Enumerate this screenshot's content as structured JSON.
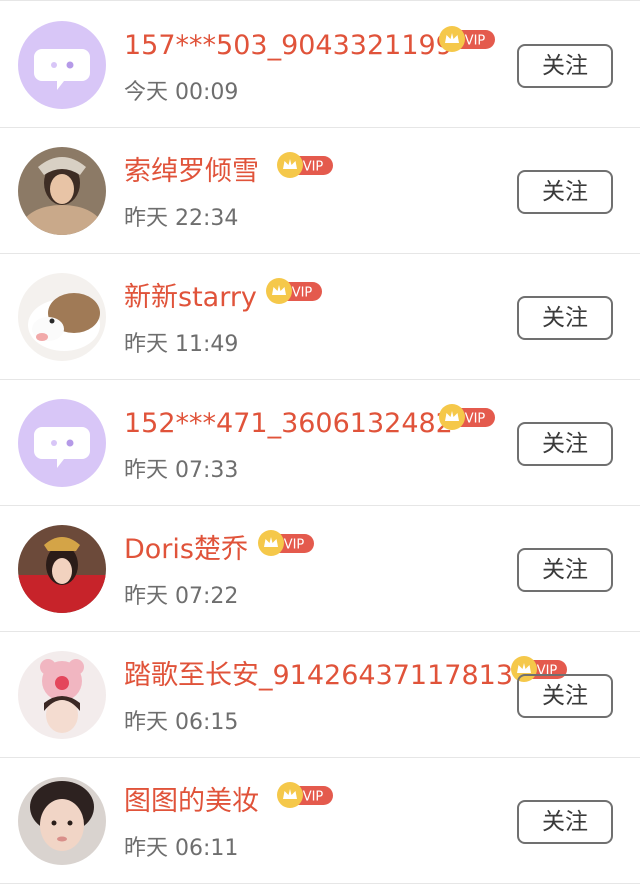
{
  "badge_label": "VIP",
  "follow_label": "关注",
  "colors": {
    "name": "#e0533a",
    "vip_badge": "#e45a4d",
    "crown": "#f5c84a",
    "default_avatar": "#d8c6f7"
  },
  "users": [
    {
      "name": "157***503_9043321199",
      "time": "今天 00:09",
      "avatar": "default-chat-icon"
    },
    {
      "name": "索绰罗倾雪",
      "time": "昨天 22:34",
      "avatar": "photo"
    },
    {
      "name": "新新starry",
      "time": "昨天 11:49",
      "avatar": "photo"
    },
    {
      "name": "152***471_3606132482",
      "time": "昨天 07:33",
      "avatar": "default-chat-icon"
    },
    {
      "name": "Doris楚乔",
      "time": "昨天 07:22",
      "avatar": "photo"
    },
    {
      "name": "踏歌至长安_91426437117813",
      "time": "昨天 06:15",
      "avatar": "photo"
    },
    {
      "name": "图图的美妆",
      "time": "昨天 06:11",
      "avatar": "photo"
    }
  ]
}
